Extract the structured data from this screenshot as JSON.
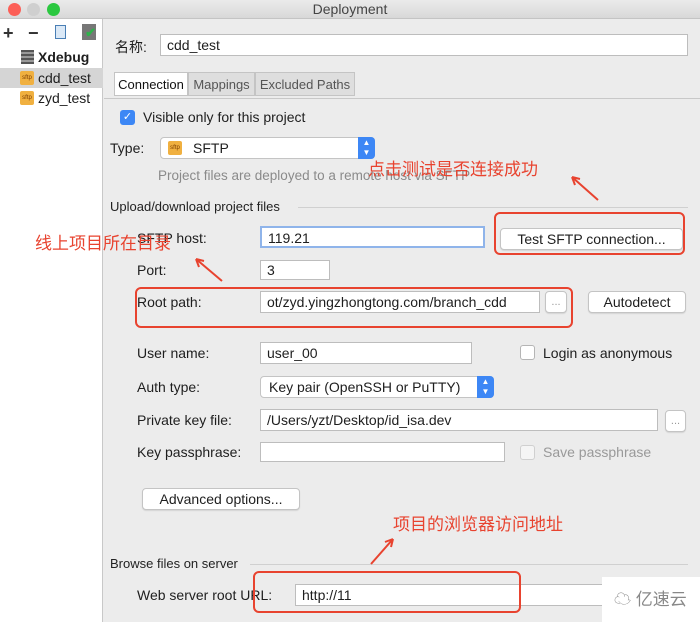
{
  "window": {
    "title": "Deployment"
  },
  "toolbar": {
    "add": "+",
    "remove": "−"
  },
  "sidebar": {
    "items": [
      {
        "label": "Xdebug",
        "icon": "server-icon"
      },
      {
        "label": "cdd_test",
        "icon": "sftp-icon",
        "selected": true
      },
      {
        "label": "zyd_test",
        "icon": "sftp-icon"
      }
    ]
  },
  "name": {
    "label": "名称:",
    "value": "cdd_test"
  },
  "tabs": [
    {
      "label": "Connection",
      "active": true
    },
    {
      "label": "Mappings"
    },
    {
      "label": "Excluded Paths"
    }
  ],
  "connection": {
    "visible_only": {
      "label": "Visible only for this project",
      "checked": true
    },
    "type": {
      "label": "Type:",
      "value": "SFTP",
      "icon_text": "sftp"
    },
    "hint": "Project files are deployed to a remote host via SFTP",
    "upload_section": "Upload/download project files",
    "host": {
      "label": "SFTP host:",
      "value": "119.21"
    },
    "test_button": "Test SFTP connection...",
    "port": {
      "label": "Port:",
      "value": "3"
    },
    "root_path": {
      "label": "Root path:",
      "value": "ot/zyd.yingzhongtong.com/branch_cdd",
      "browse": "...",
      "autodetect": "Autodetect"
    },
    "user": {
      "label": "User name:",
      "value": "user_00"
    },
    "anonymous": {
      "label": "Login as anonymous",
      "checked": false
    },
    "auth": {
      "label": "Auth type:",
      "value": "Key pair (OpenSSH or PuTTY)"
    },
    "private_key": {
      "label": "Private key file:",
      "value": "/Users/yzt/Desktop/id_isa.dev",
      "browse": "..."
    },
    "passphrase": {
      "label": "Key passphrase:",
      "value": ""
    },
    "save_passphrase": {
      "label": "Save passphrase",
      "checked": false
    },
    "advanced": "Advanced options...",
    "browse_section": "Browse files on server",
    "web_url": {
      "label": "Web server root URL:",
      "value": "http://11"
    }
  },
  "annotations": {
    "test": "点击测试是否连接成功",
    "root": "线上项目所在目录",
    "url": "项目的浏览器访问地址",
    "color": "#e8432f"
  },
  "watermark": "亿速云"
}
